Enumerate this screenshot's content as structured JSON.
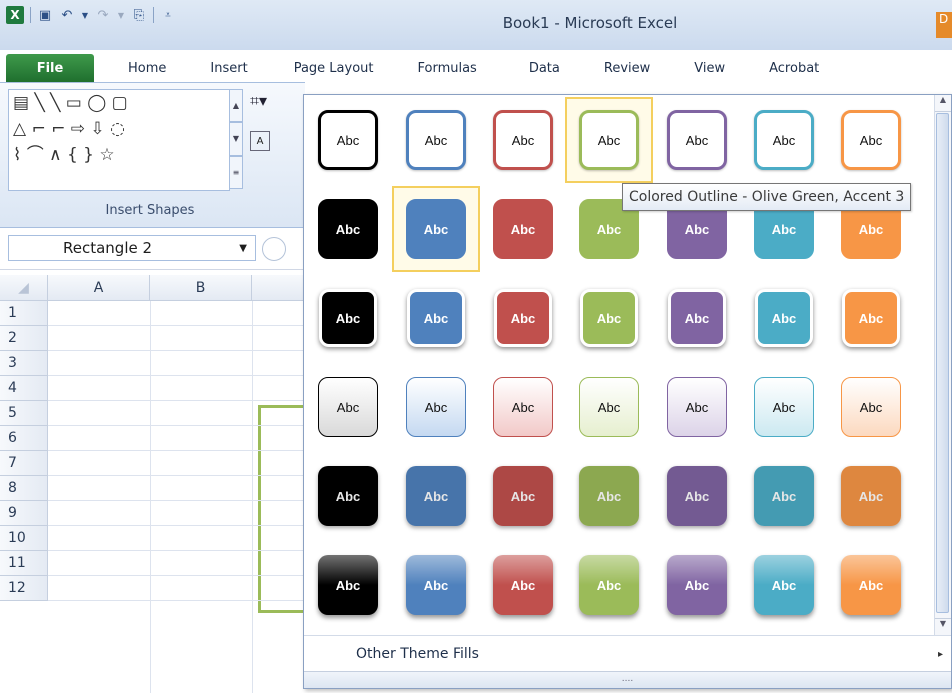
{
  "window": {
    "title": "Book1 - Microsoft Excel",
    "right_tab_stub": "D"
  },
  "qat": {
    "logo": "X"
  },
  "tabs": [
    "File",
    "Home",
    "Insert",
    "Page Layout",
    "Formulas",
    "Data",
    "Review",
    "View",
    "Acrobat"
  ],
  "ribbon": {
    "shape_rows": [
      "▤ ╲ ╲ ▭ ◯ ▢",
      "△ ⌐ ⌐ ⇨ ⇩ ◌",
      "⌇ ⌒ ∧ { } ☆"
    ],
    "group_label": "Insert Shapes",
    "text_box_icon": "A"
  },
  "name_box": {
    "value": "Rectangle 2"
  },
  "columns": [
    "A",
    "B"
  ],
  "rows": [
    "1",
    "2",
    "3",
    "4",
    "5",
    "6",
    "7",
    "8",
    "9",
    "10",
    "11",
    "12"
  ],
  "gallery": {
    "swatch_text": "Abc",
    "accent_colors": [
      "#000000",
      "#4f81bd",
      "#c0504d",
      "#9bbb59",
      "#8064a2",
      "#4bacc6",
      "#f79646"
    ],
    "subtle_fills": [
      "#d9d9d9",
      "#c5d9f1",
      "#f2c9c8",
      "#e6efcf",
      "#dcd3e8",
      "#cce9f1",
      "#fcd9bf"
    ],
    "hover": {
      "row": 0,
      "col": 3
    },
    "selected": {
      "row": 1,
      "col": 1
    },
    "footer_label": "Other Theme Fills",
    "footer_arrow": "▸",
    "grip": "....",
    "scroll_up": "▲",
    "scroll_down": "▼"
  },
  "tooltip": {
    "text": "Colored Outline - Olive Green, Accent 3"
  }
}
